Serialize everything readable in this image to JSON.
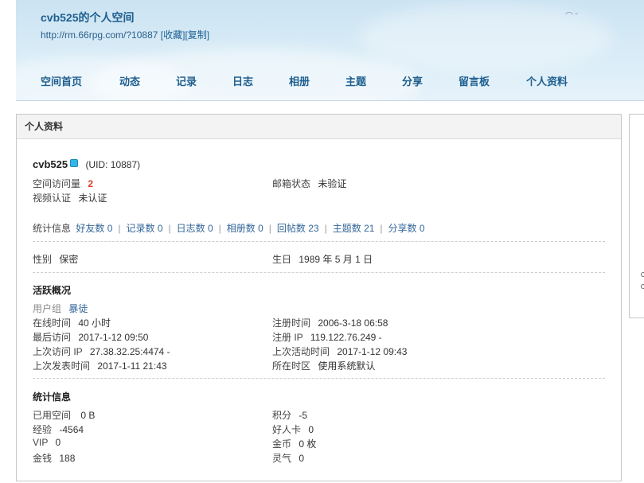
{
  "header": {
    "title": "cvb525的个人空间",
    "url": "http://rm.66rpg.com/?10887",
    "favorite_label": "[收藏]",
    "copy_label": "[复制]"
  },
  "nav": [
    {
      "label": "空间首页"
    },
    {
      "label": "动态"
    },
    {
      "label": "记录"
    },
    {
      "label": "日志"
    },
    {
      "label": "相册"
    },
    {
      "label": "主题"
    },
    {
      "label": "分享"
    },
    {
      "label": "留言板"
    },
    {
      "label": "个人资料"
    }
  ],
  "panel": {
    "title": "个人资料"
  },
  "profile": {
    "username": "cvb525",
    "uid": "(UID: 10887)",
    "visits_label": "空间访问量",
    "visits_value": "2",
    "email_label": "邮箱状态",
    "email_value": "未验证",
    "video_label": "视频认证",
    "video_value": "未认证"
  },
  "stats": {
    "label": "统计信息",
    "items": [
      {
        "text": "好友数 0"
      },
      {
        "text": "记录数 0"
      },
      {
        "text": "日志数 0"
      },
      {
        "text": "相册数 0"
      },
      {
        "text": "回帖数 23"
      },
      {
        "text": "主题数 21"
      },
      {
        "text": "分享数 0"
      }
    ]
  },
  "basic": {
    "gender_label": "性别",
    "gender_value": "保密",
    "birthday_label": "生日",
    "birthday_value": "1989 年 5 月 1 日"
  },
  "activity": {
    "title": "活跃概况",
    "usergroup_label": "用户组",
    "usergroup_value": "暴徒",
    "online_label": "在线时间",
    "online_value": "40 小时",
    "register_label": "注册时间",
    "register_value": "2006-3-18 06:58",
    "last_visit_label": "最后访问",
    "last_visit_value": "2017-1-12 09:50",
    "register_ip_label": "注册 IP",
    "register_ip_value": "119.122.76.249 -",
    "last_ip_label": "上次访问 IP",
    "last_ip_value": "27.38.32.25:4474 -",
    "last_active_label": "上次活动时间",
    "last_active_value": "2017-1-12 09:43",
    "last_post_label": "上次发表时间",
    "last_post_value": "2017-1-11 21:43",
    "timezone_label": "所在时区",
    "timezone_value": "使用系统默认"
  },
  "statinfo": {
    "title": "统计信息",
    "space_label": "已用空间",
    "space_value": "0 B",
    "points_label": "积分",
    "points_value": "-5",
    "exp_label": "经验",
    "exp_value": "-4564",
    "goodcard_label": "好人卡",
    "goodcard_value": "0",
    "vip_label": "VIP",
    "vip_value": "0",
    "gold_label": "金币",
    "gold_value": "0 枚",
    "money_label": "金钱",
    "money_value": "188",
    "spirit_label": "灵气",
    "spirit_value": "0"
  }
}
